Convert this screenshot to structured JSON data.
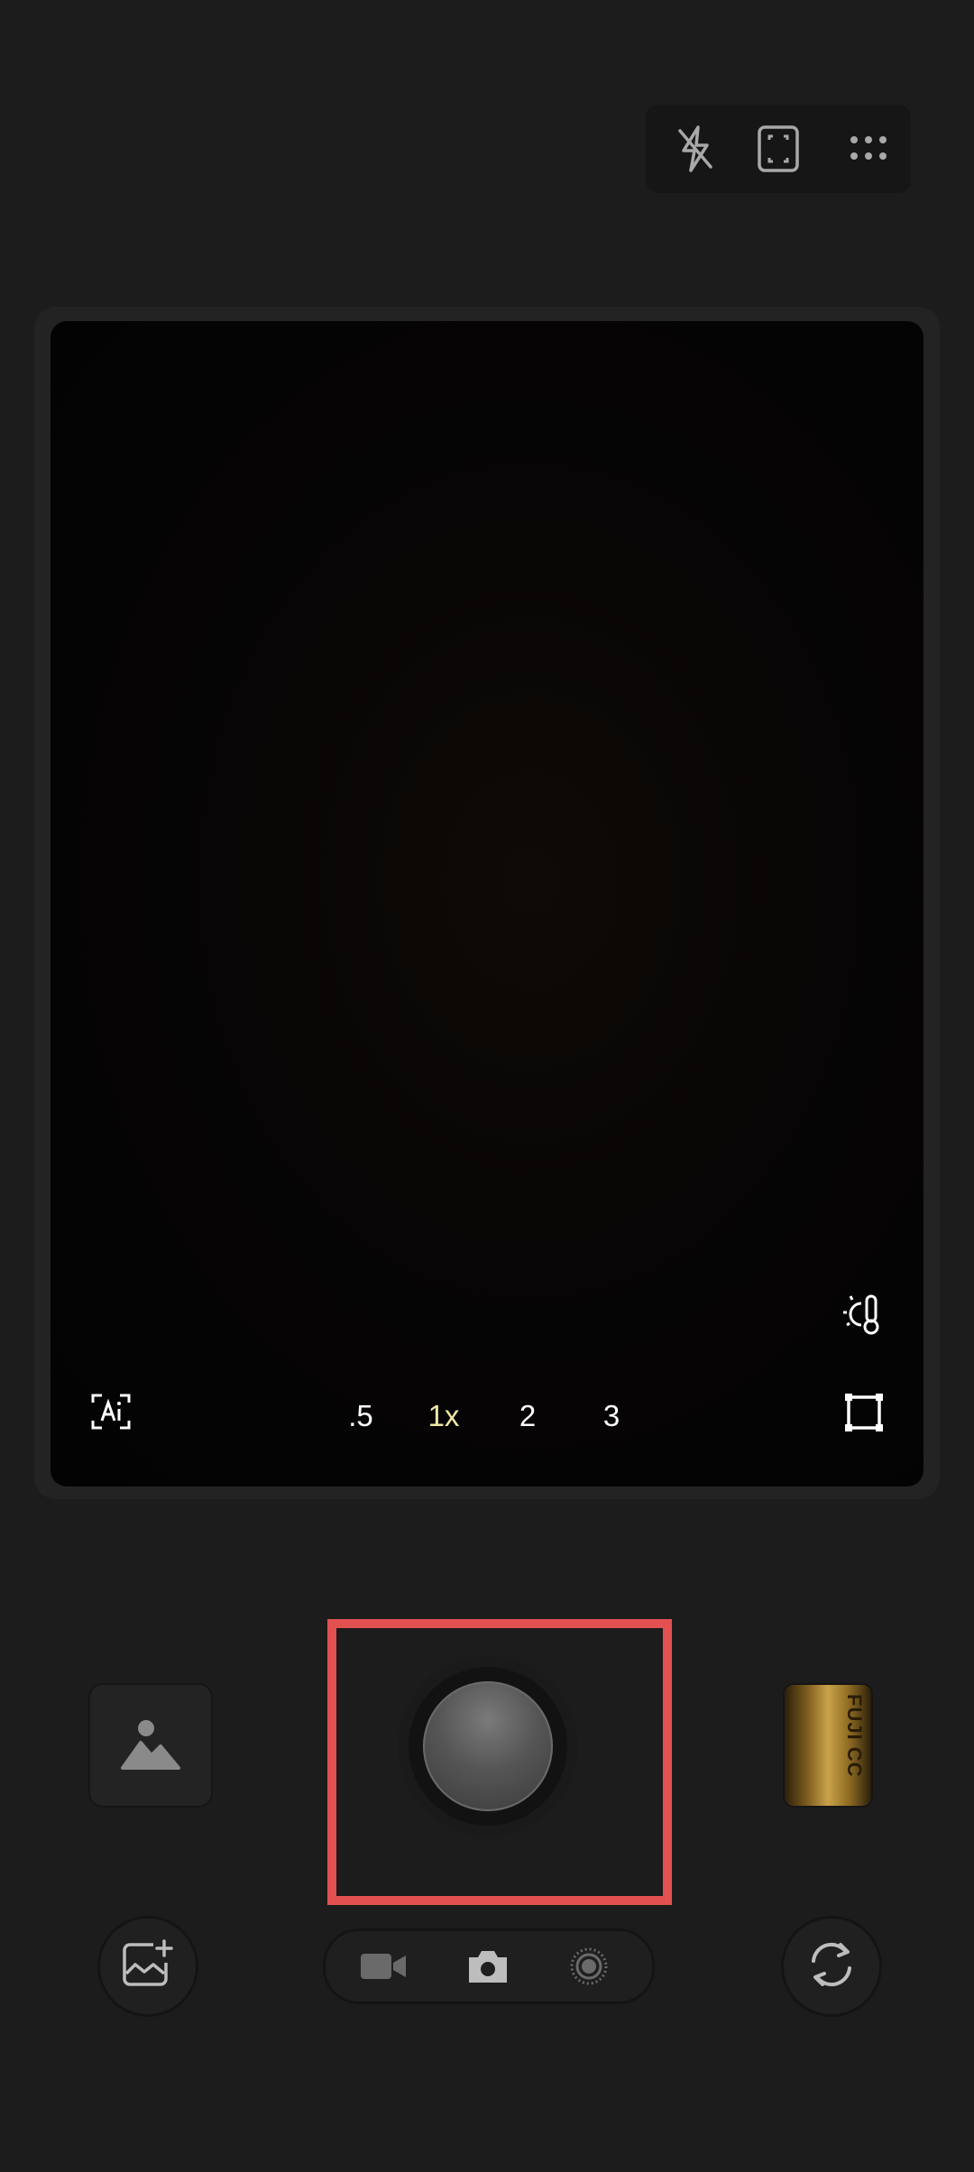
{
  "top_bar": {
    "icons": [
      "flash-off-icon",
      "aspect-frame-icon",
      "more-options-icon"
    ]
  },
  "viewfinder": {
    "ai_icon": "ai-scene-icon",
    "temperature_icon": "white-balance-temperature-icon",
    "crop_icon": "crop-frame-icon",
    "zoom_levels": [
      ".5",
      "1x",
      "2",
      "3"
    ],
    "active_zoom": "1x"
  },
  "controls": {
    "gallery_icon": "gallery-image-icon",
    "shutter": "shutter-button",
    "film_label": "FUJI CC",
    "edit_icon": "add-image-icon",
    "switch_icon": "switch-camera-icon"
  },
  "modes": [
    "video-mode-icon",
    "photo-mode-icon",
    "live-mode-icon"
  ],
  "colors": {
    "background": "#1c1c1c",
    "active_zoom": "#f1e8a6",
    "highlight": "#e25150"
  }
}
